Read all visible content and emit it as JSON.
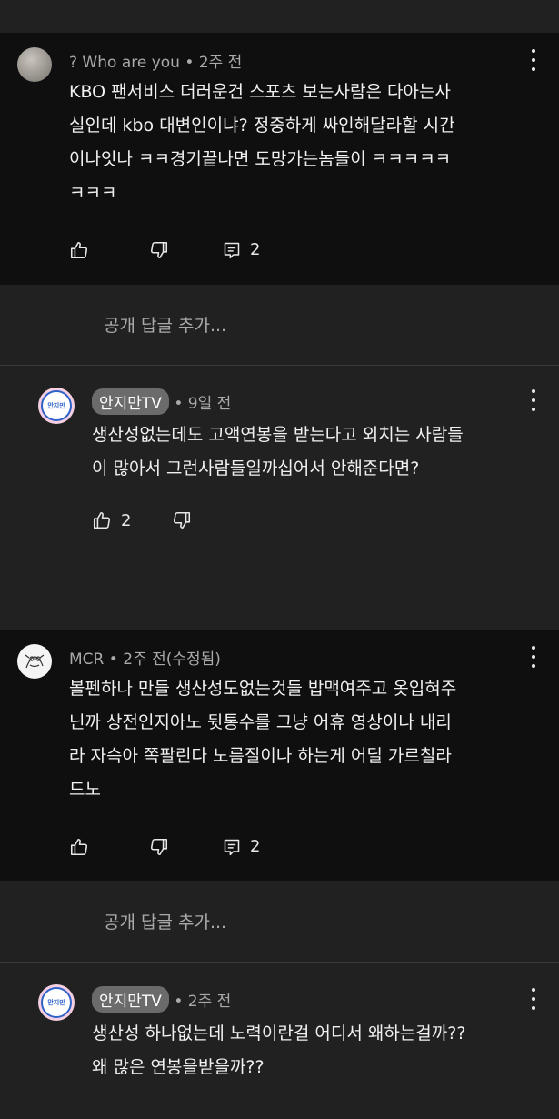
{
  "comments": [
    {
      "author": "? Who are you",
      "time": "2주 전",
      "lines": [
        "KBO 팬서비스 더러운건 스포츠 보는사람은 다아는사",
        "실인데 kbo 대변인이냐? 정중하게 싸인해달라할 시간",
        "이나잇나 ㅋㅋ경기끝나면 도망가는놈들이 ㅋㅋㅋㅋㅋ",
        "ㅋㅋㅋ"
      ],
      "like_count": "",
      "reply_count": "2"
    },
    {
      "author": "MCR",
      "time": "2주 전(수정됨)",
      "lines": [
        "볼펜하나 만들 생산성도없는것들 밥맥여주고 옷입혀주",
        "닌까 상전인지아노 뒷통수를 그냥 어휴 영상이나 내리",
        "라 자슥아 쪽팔린다 노름질이나 하는게 어딜 가르칠라",
        "드노"
      ],
      "like_count": "",
      "reply_count": "2"
    }
  ],
  "add_reply": {
    "placeholder": "공개 답글 추가..."
  },
  "replies": [
    {
      "author": "안지만TV",
      "time": "9일 전",
      "lines": [
        "생산성없는데도 고액연봉을 받는다고 외치는 사람들",
        "이 많아서 그런사람들일까십어서 안해준다면?"
      ],
      "like_count": "2"
    },
    {
      "author": "안지만TV",
      "time": "2주 전",
      "lines": [
        "생산성 하나없는데 노력이란걸 어디서 왜하는걸까??",
        "왜 많은 연봉을받을까??"
      ],
      "like_count": ""
    }
  ],
  "avatar_badge_text": "안지만",
  "icons": {
    "like": "thumbs-up-icon",
    "dislike": "thumbs-down-icon",
    "replies": "comment-icon",
    "menu": "more-vertical-icon"
  },
  "colors": {
    "comment_bg": "#0f0f0f",
    "reply_bg": "#212121",
    "meta_text": "#aaaaaa",
    "body_text": "#f1f1f1",
    "chip_bg": "#6b6b6b"
  }
}
